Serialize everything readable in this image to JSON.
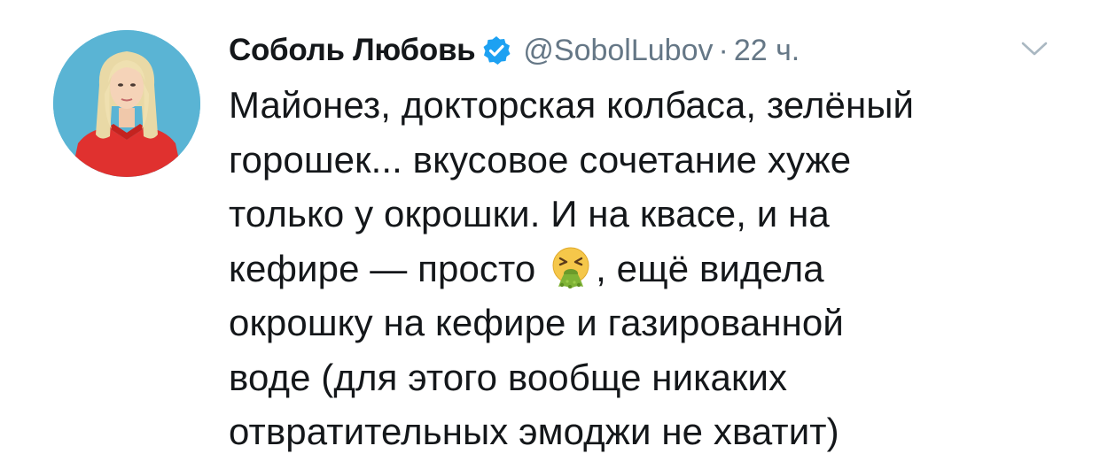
{
  "tweet": {
    "author": {
      "display_name": "Соболь Любовь",
      "handle": "@SobolLubov",
      "verified": true,
      "avatar": "avatar-photo"
    },
    "separator": "·",
    "time": "22 ч.",
    "menu_icon": "chevron-down-icon",
    "text_lines": [
      "Майонез, докторская колбаса, зелёный",
      "горошек... вкусовое сочетание хуже",
      "только у окрошки. И на квасе, и на",
      "кефире — просто",
      ", ещё видела",
      "окрошку на кефире и газированной",
      "воде (для этого вообще никаких",
      "отвратительных эмоджи не хватит)"
    ],
    "emoji": "vomiting-face-emoji"
  },
  "colors": {
    "text": "#14171a",
    "secondary": "#657786",
    "verified_blue": "#1da1f2",
    "avatar_bg": "#5ab4d4",
    "chevron": "#aab8c2"
  }
}
